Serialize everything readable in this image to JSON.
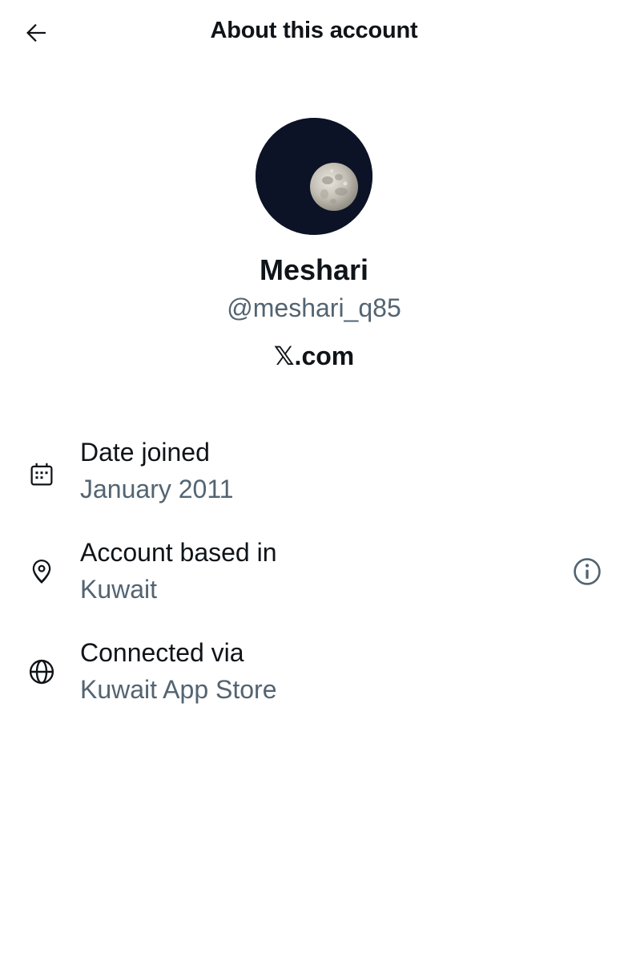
{
  "header": {
    "title": "About this account",
    "back_icon": "arrow-left-icon"
  },
  "profile": {
    "avatar_icon": "moon-avatar",
    "name": "Meshari",
    "handle": "@meshari_q85",
    "platform": "𝕏.com"
  },
  "rows": [
    {
      "icon": "calendar-icon",
      "label": "Date joined",
      "value": "January 2011"
    },
    {
      "icon": "location-pin-icon",
      "label": "Account based in",
      "value": "Kuwait",
      "action_icon": "info-icon"
    },
    {
      "icon": "globe-icon",
      "label": "Connected via",
      "value": "Kuwait App Store"
    }
  ],
  "colors": {
    "text_primary": "#0f1419",
    "text_secondary": "#536471",
    "avatar_background": "#0d1326",
    "background": "#ffffff"
  }
}
